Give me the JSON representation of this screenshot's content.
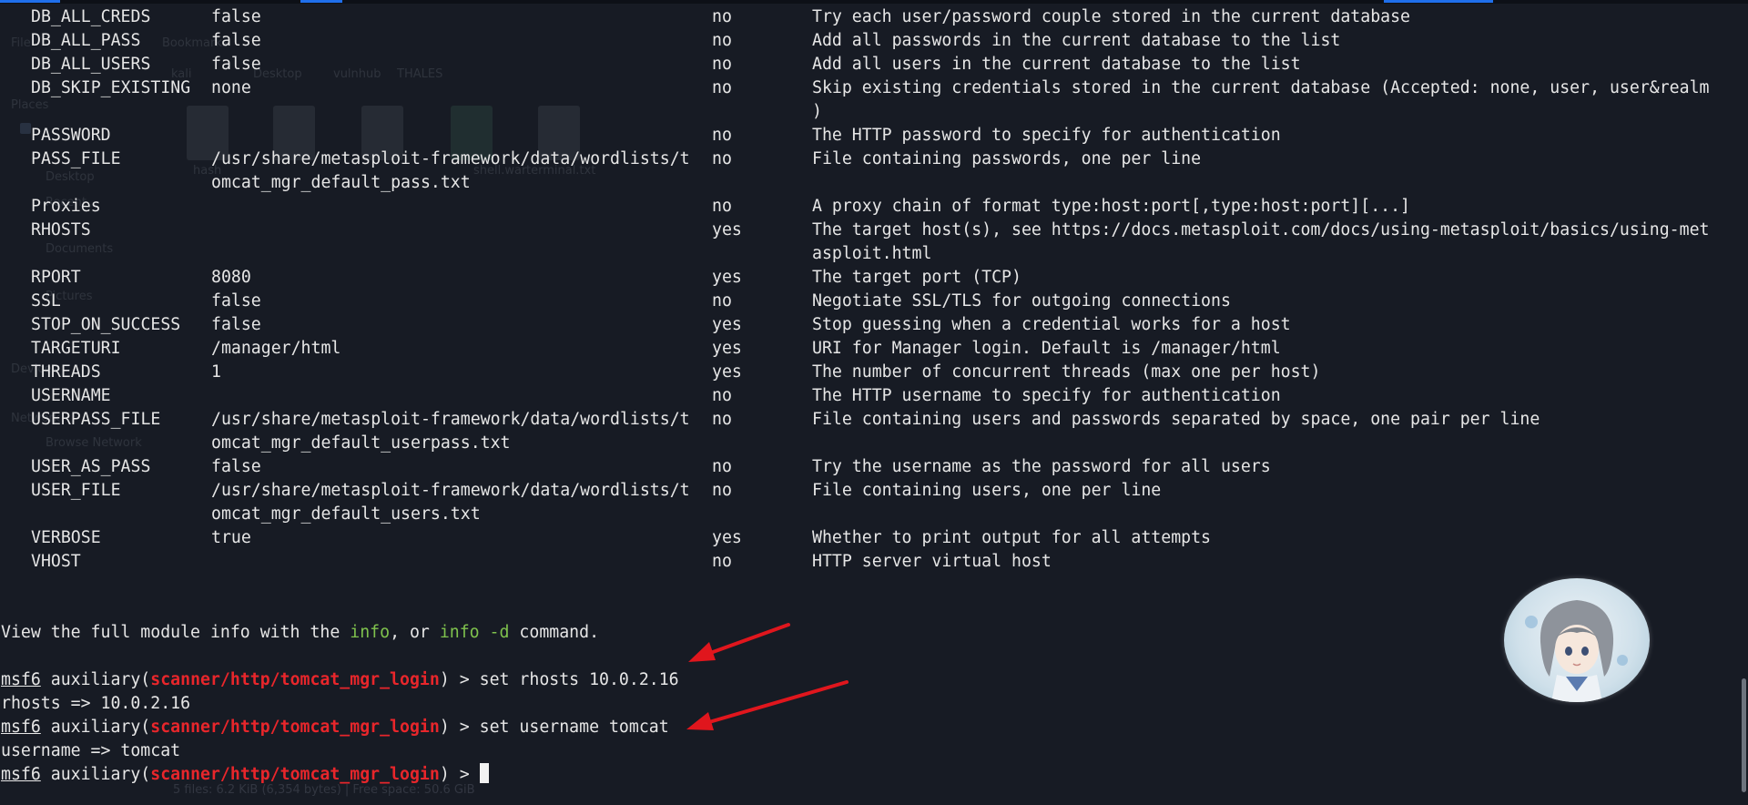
{
  "window": {
    "ghost_file_manager": {
      "menu": "File",
      "bookmarks": "Bookmarks",
      "path": [
        "kali",
        "Desktop",
        "vulnhub",
        "THALES"
      ],
      "places_heading": "Places",
      "places": [
        "Desktop",
        "Recent",
        "Documents",
        "Pictures"
      ],
      "devices_heading": "Devices",
      "network_heading": "Network",
      "network_item": "Browse Network",
      "files": [
        "hash",
        "",
        "",
        "shell.war",
        "terminal.txt"
      ],
      "status": "5 files: 6.2 KiB (6,354 bytes) | Free space: 50.6 GiB"
    }
  },
  "terminal": {
    "options": [
      {
        "name": "DB_ALL_CREDS",
        "value": "false",
        "required": "no",
        "desc": "Try each user/password couple stored in the current database"
      },
      {
        "name": "DB_ALL_PASS",
        "value": "false",
        "required": "no",
        "desc": "Add all passwords in the current database to the list"
      },
      {
        "name": "DB_ALL_USERS",
        "value": "false",
        "required": "no",
        "desc": "Add all users in the current database to the list"
      },
      {
        "name": "DB_SKIP_EXISTING",
        "value": "none",
        "required": "no",
        "desc": "Skip existing credentials stored in the current database (Accepted: none, user, user&realm",
        "desc2": ")"
      },
      {
        "name": "PASSWORD",
        "value": "",
        "required": "no",
        "desc": "The HTTP password to specify for authentication"
      },
      {
        "name": "PASS_FILE",
        "value": "/usr/share/metasploit-framework/data/wordlists/t",
        "value2": "omcat_mgr_default_pass.txt",
        "required": "no",
        "desc": "File containing passwords, one per line"
      },
      {
        "name": "Proxies",
        "value": "",
        "required": "no",
        "desc": "A proxy chain of format type:host:port[,type:host:port][...]"
      },
      {
        "name": "RHOSTS",
        "value": "",
        "required": "yes",
        "desc": "The target host(s), see https://docs.metasploit.com/docs/using-metasploit/basics/using-met",
        "desc2": "asploit.html"
      },
      {
        "name": "RPORT",
        "value": "8080",
        "required": "yes",
        "desc": "The target port (TCP)"
      },
      {
        "name": "SSL",
        "value": "false",
        "required": "no",
        "desc": "Negotiate SSL/TLS for outgoing connections"
      },
      {
        "name": "STOP_ON_SUCCESS",
        "value": "false",
        "required": "yes",
        "desc": "Stop guessing when a credential works for a host"
      },
      {
        "name": "TARGETURI",
        "value": "/manager/html",
        "required": "yes",
        "desc": "URI for Manager login. Default is /manager/html"
      },
      {
        "name": "THREADS",
        "value": "1",
        "required": "yes",
        "desc": "The number of concurrent threads (max one per host)"
      },
      {
        "name": "USERNAME",
        "value": "",
        "required": "no",
        "desc": "The HTTP username to specify for authentication"
      },
      {
        "name": "USERPASS_FILE",
        "value": "/usr/share/metasploit-framework/data/wordlists/t",
        "value2": "omcat_mgr_default_userpass.txt",
        "required": "no",
        "desc": "File containing users and passwords separated by space, one pair per line"
      },
      {
        "name": "USER_AS_PASS",
        "value": "false",
        "required": "no",
        "desc": "Try the username as the password for all users"
      },
      {
        "name": "USER_FILE",
        "value": "/usr/share/metasploit-framework/data/wordlists/t",
        "value2": "omcat_mgr_default_users.txt",
        "required": "no",
        "desc": "File containing users, one per line"
      },
      {
        "name": "VERBOSE",
        "value": "true",
        "required": "yes",
        "desc": "Whether to print output for all attempts"
      },
      {
        "name": "VHOST",
        "value": "",
        "required": "no",
        "desc": "HTTP server virtual host"
      }
    ],
    "info_line": {
      "prefix": "View the full module info with the ",
      "cmd1": "info",
      "mid": ", or ",
      "cmd2": "info -d",
      "suffix": " command."
    },
    "prompt": {
      "msf": "msf6",
      "before": " auxiliary(",
      "module": "scanner/http/tomcat_mgr_login",
      "after": ") > "
    },
    "commands": [
      "set rhosts 10.0.2.16",
      "set username tomcat",
      ""
    ],
    "outputs": [
      "rhosts => 10.0.2.16",
      "username => tomcat"
    ]
  },
  "colors": {
    "background": "#171b24",
    "text": "#e6e6e6",
    "info_green": "#7fc24d",
    "module_red": "#e8262b",
    "annotation_arrow": "#e0161d"
  },
  "annotation": {
    "arrow_count": 2
  }
}
